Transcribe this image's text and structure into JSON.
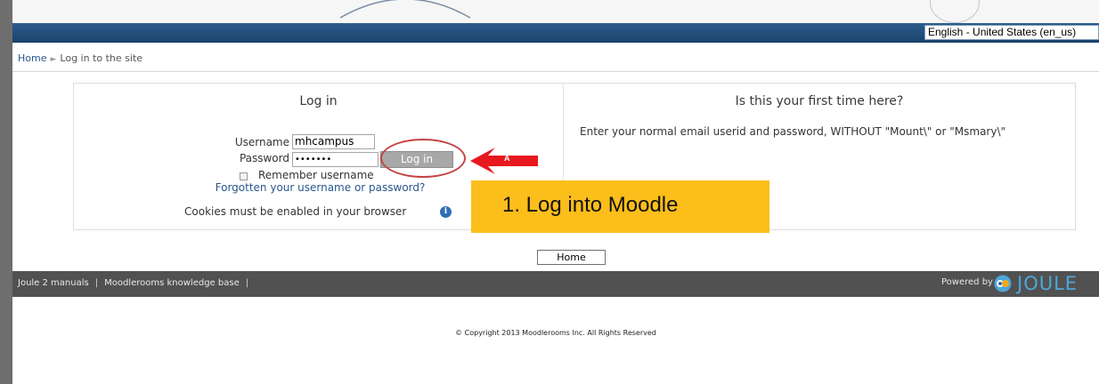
{
  "header": {
    "language_select": "English - United States (en_us)"
  },
  "breadcrumb": {
    "home": "Home",
    "separator": "►",
    "current": "Log in to the site"
  },
  "login": {
    "title": "Log in",
    "username_label": "Username",
    "username_value": "mhcampus",
    "password_label": "Password",
    "password_value": "•••••••",
    "login_button": "Log in",
    "remember_label": "Remember username",
    "forgot_link": "Forgotten your username or password?",
    "cookies_text": "Cookies must be enabled in your browser",
    "info_icon": "i"
  },
  "signup": {
    "title": "Is this your first time here?",
    "text": "Enter your normal email userid and password, WITHOUT \"Mount\\\" or \"Msmary\\\""
  },
  "annotations": {
    "arrow_label": "A",
    "callout": "1. Log into Moodle",
    "callout_color": "#fbbe1a",
    "highlight_color": "#c44545",
    "arrow_color": "#e8181f"
  },
  "home_button": "Home",
  "footer": {
    "links": [
      "Joule 2 manuals",
      "Moodlerooms knowledge base"
    ],
    "divider": "|",
    "powered_by": "Powered by",
    "brand": "JOULE"
  },
  "copyright": "© Copyright 2013 Moodlerooms Inc. All Rights Reserved"
}
